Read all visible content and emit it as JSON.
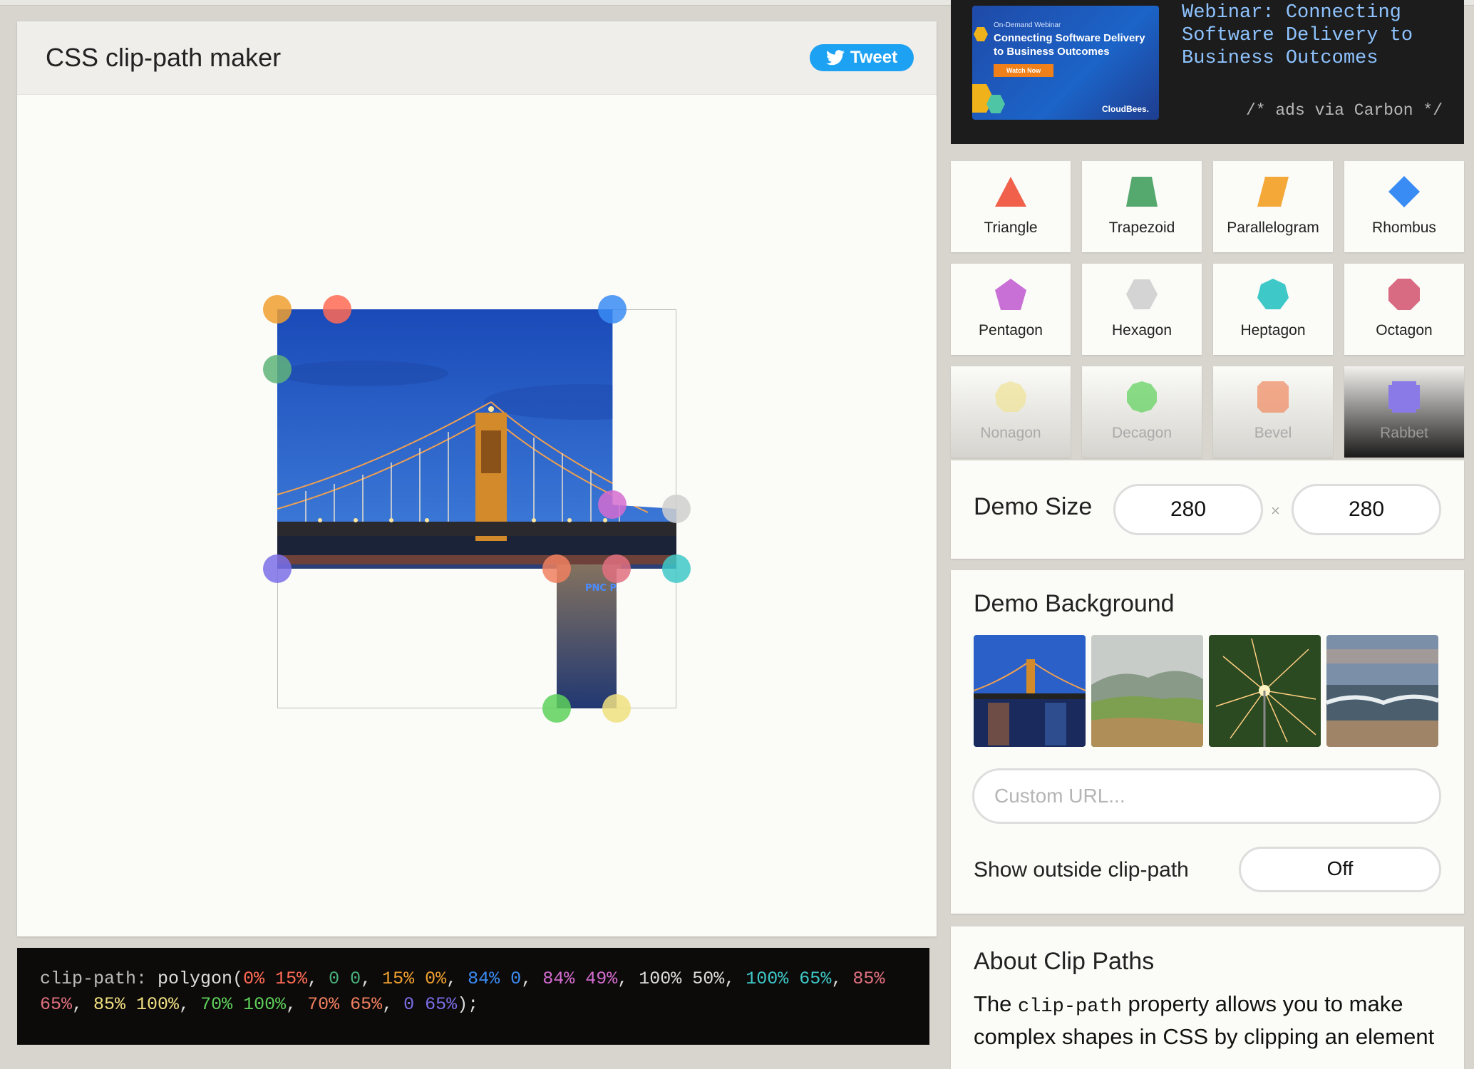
{
  "app": {
    "title": "CSS clip-path maker",
    "tweet_label": "Tweet"
  },
  "code": {
    "property": "clip-path:",
    "func_open": "polygon(",
    "func_close": ");",
    "points": [
      {
        "text": "0% 15%",
        "color": "#ff6b55"
      },
      {
        "text": "0 0",
        "color": "#48b07a"
      },
      {
        "text": "15% 0%",
        "color": "#f0a030"
      },
      {
        "text": "84% 0",
        "color": "#3a8cf5"
      },
      {
        "text": "84% 49%",
        "color": "#d46cd0"
      },
      {
        "text": "100% 50%",
        "color": "#dddddd"
      },
      {
        "text": "100% 65%",
        "color": "#3ec8c8"
      },
      {
        "text": "85% 65%",
        "color": "#e07080"
      },
      {
        "text": "85% 100%",
        "color": "#f0e080"
      },
      {
        "text": "70% 100%",
        "color": "#5ed15a"
      },
      {
        "text": "70% 65%",
        "color": "#f08060"
      },
      {
        "text": "0 65%",
        "color": "#7a6ee8"
      }
    ]
  },
  "handles": [
    {
      "color": "#5fb37a"
    },
    {
      "color": "#f0a030"
    },
    {
      "color": "#ff6b55"
    },
    {
      "color": "#3a8cf5"
    },
    {
      "color": "#d46cd0"
    },
    {
      "color": "#cfcfcf"
    },
    {
      "color": "#3ec8c8"
    },
    {
      "color": "#e07080"
    },
    {
      "color": "#f0e080"
    },
    {
      "color": "#5ed15a"
    },
    {
      "color": "#f08060"
    },
    {
      "color": "#7a6ee8"
    }
  ],
  "ad": {
    "banner_small": "On-Demand Webinar",
    "banner_big": "Connecting Software Delivery to Business Outcomes",
    "banner_cta": "Watch Now",
    "banner_brand": "CloudBees.",
    "text": "Webinar: Connecting Software Delivery to Business Outcomes",
    "credit": "/* ads via Carbon */"
  },
  "shapes": [
    {
      "label": "Triangle",
      "color": "#f0604a",
      "icon": "triangle-icon"
    },
    {
      "label": "Trapezoid",
      "color": "#55a86e",
      "icon": "trapezoid-icon"
    },
    {
      "label": "Parallelogram",
      "color": "#f3a838",
      "icon": "parallelogram-icon"
    },
    {
      "label": "Rhombus",
      "color": "#3a8cf5",
      "icon": "rhombus-icon"
    },
    {
      "label": "Pentagon",
      "color": "#c970d6",
      "icon": "pentagon-icon"
    },
    {
      "label": "Hexagon",
      "color": "#d4d4d4",
      "icon": "hexagon-icon"
    },
    {
      "label": "Heptagon",
      "color": "#3ec8c8",
      "icon": "heptagon-icon"
    },
    {
      "label": "Octagon",
      "color": "#d86a82",
      "icon": "octagon-icon"
    },
    {
      "label": "Nonagon",
      "color": "#f0e496",
      "icon": "nonagon-icon"
    },
    {
      "label": "Decagon",
      "color": "#5ed15a",
      "icon": "decagon-icon"
    },
    {
      "label": "Bevel",
      "color": "#f08a60",
      "icon": "bevel-icon"
    },
    {
      "label": "Rabbet",
      "color": "#8a7ae8",
      "icon": "rabbet-icon"
    }
  ],
  "demo_size": {
    "label": "Demo Size",
    "width": "280",
    "height": "280",
    "separator": "×"
  },
  "demo_background": {
    "label": "Demo Background",
    "thumbnails": [
      "bridge-night-thumbnail",
      "green-hills-thumbnail",
      "sparkler-thumbnail",
      "sea-waves-thumbnail"
    ],
    "url_placeholder": "Custom URL...",
    "outside_label": "Show outside clip-path",
    "outside_value": "Off"
  },
  "about": {
    "title": "About Clip Paths",
    "text_before": "The ",
    "code": "clip-path",
    "text_after": " property allows you to make complex shapes in CSS by clipping an element"
  }
}
